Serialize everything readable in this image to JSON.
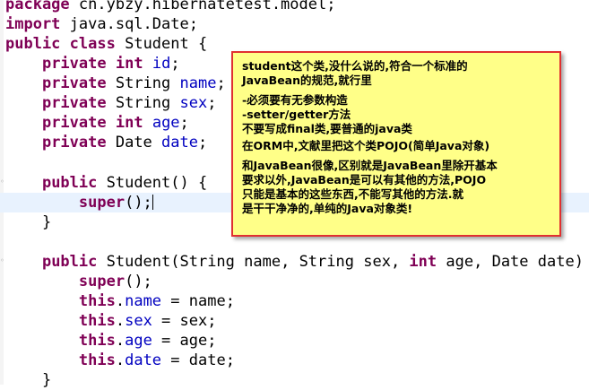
{
  "code": {
    "l1": {
      "kw": "package",
      "rest": " cn.ybzy.hibernatetest.model;"
    },
    "l2": {
      "kw": "import",
      "rest": " java.sql.Date;"
    },
    "l3": {
      "kw1": "public",
      "kw2": "class",
      "rest": " Student {"
    },
    "l4": {
      "indent": "    ",
      "kw1": "private",
      "kw2": "int",
      "field": "id",
      "end": ";"
    },
    "l5": {
      "indent": "    ",
      "kw": "private",
      "type": " String ",
      "field": "name",
      "end": ";"
    },
    "l6": {
      "indent": "    ",
      "kw": "private",
      "type": " String ",
      "field": "sex",
      "end": ";"
    },
    "l7": {
      "indent": "    ",
      "kw1": "private",
      "kw2": "int",
      "field": "age",
      "end": ";"
    },
    "l8": {
      "indent": "    ",
      "kw": "private",
      "type": " Date ",
      "field": "date",
      "end": ";"
    },
    "l9": {
      "indent": "    ",
      "kw": "public",
      "rest": " Student() {"
    },
    "l10": {
      "indent": "        ",
      "kw": "super",
      "rest": "();"
    },
    "l11": {
      "text": "    }"
    },
    "l12": {
      "indent": "    ",
      "kw1": "public",
      "p1": " Student(String ",
      "f1": "name",
      "p2": ", String ",
      "f2": "sex",
      "p3": ", ",
      "kw2": "int",
      "p4": " ",
      "f3": "age",
      "p5": ", Date ",
      "f4": "date",
      "p6": ") {"
    },
    "l13": {
      "indent": "        ",
      "kw": "super",
      "rest": "();"
    },
    "l14": {
      "indent": "        ",
      "kw": "this",
      "dot": ".",
      "field": "name",
      "rest": " = name;"
    },
    "l15": {
      "indent": "        ",
      "kw": "this",
      "dot": ".",
      "field": "sex",
      "rest": " = sex;"
    },
    "l16": {
      "indent": "        ",
      "kw": "this",
      "dot": ".",
      "field": "age",
      "rest": " = age;"
    },
    "l17": {
      "indent": "        ",
      "kw": "this",
      "dot": ".",
      "field": "date",
      "rest": " = date;"
    },
    "l18": {
      "text": "    }"
    }
  },
  "note": {
    "p1_line1": "student这个类,没什么说的,符合一个标准的",
    "p1_line2": "JavaBean的规范,就行里",
    "p2_line1": "-必须要有无参数构造",
    "p2_line2": "-setter/getter方法",
    "p2_line3": "不要写成final类,要普通的java类",
    "p3": "在ORM中,文献里把这个类POJO(简单Java对象)",
    "p4_line1": "和JavaBean很像,区别就是JavaBean里除开基本",
    "p4_line2": "要求以外,JavaBean是可以有其他的方法,POJO",
    "p4_line3": "只能是基本的这些东西,不能写其他的方法.就",
    "p4_line4": "是干干净净的,单纯的Java对象类!"
  }
}
